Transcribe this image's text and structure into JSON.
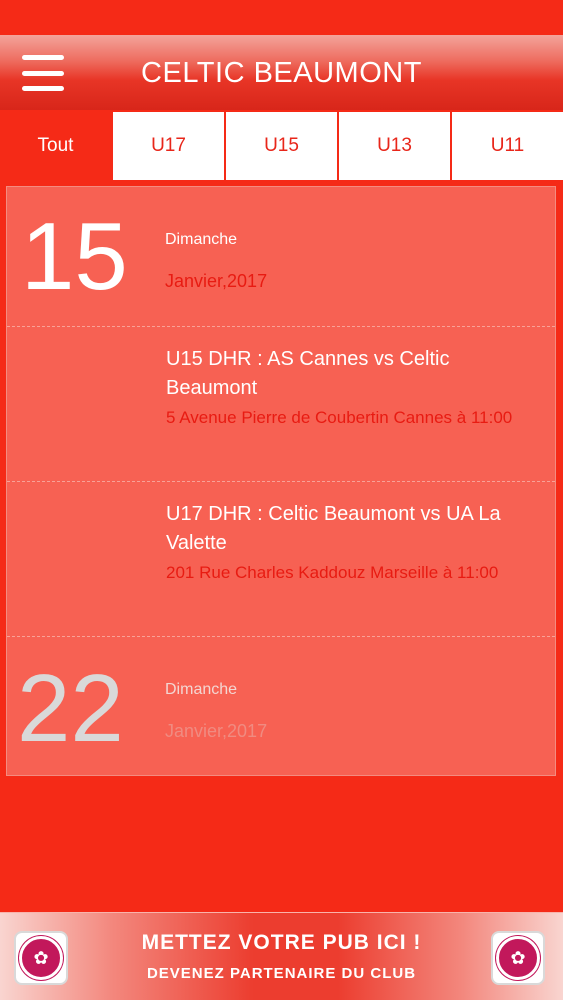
{
  "header": {
    "title": "CELTIC BEAUMONT",
    "menu_icon": "hamburger-menu-icon"
  },
  "tabs": [
    {
      "label": "Tout",
      "active": true
    },
    {
      "label": "U17",
      "active": false
    },
    {
      "label": "U15",
      "active": false
    },
    {
      "label": "U13",
      "active": false
    },
    {
      "label": "U11",
      "active": false
    }
  ],
  "days": [
    {
      "number": "15",
      "weekday": "Dimanche",
      "month": "Janvier,2017",
      "events": [
        {
          "title": "U15 DHR : AS Cannes vs Celtic Beaumont",
          "place": "5 Avenue Pierre de Coubertin Cannes à 11:00"
        },
        {
          "title": "U17 DHR : Celtic Beaumont vs UA La Valette",
          "place": "201 Rue Charles Kaddouz Marseille à 11:00"
        }
      ]
    },
    {
      "number": "22",
      "weekday": "Dimanche",
      "month": "Janvier,2017"
    }
  ],
  "ad": {
    "line1": "METTEZ VOTRE PUB ICI !",
    "line2": "DEVENEZ PARTENAIRE DU CLUB",
    "logo_icon": "club-logo-icon"
  },
  "colors": {
    "accent": "#f52a17",
    "panel": "#f76153",
    "highlight": "#e81b12"
  }
}
